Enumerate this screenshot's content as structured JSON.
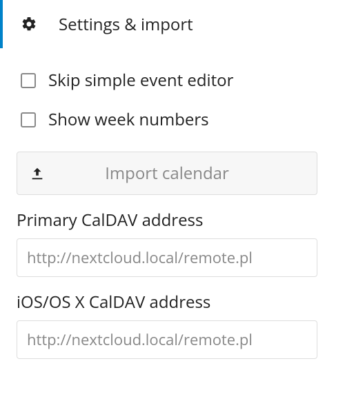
{
  "header": {
    "title": "Settings & import"
  },
  "options": {
    "skip_simple_editor": {
      "label": "Skip simple event editor",
      "checked": false
    },
    "show_week_numbers": {
      "label": "Show week numbers",
      "checked": false
    }
  },
  "import": {
    "label": "Import calendar"
  },
  "caldav": {
    "primary": {
      "label": "Primary CalDAV address",
      "value": "http://nextcloud.local/remote.pl"
    },
    "ios": {
      "label": "iOS/OS X CalDAV address",
      "value": "http://nextcloud.local/remote.pl"
    }
  }
}
